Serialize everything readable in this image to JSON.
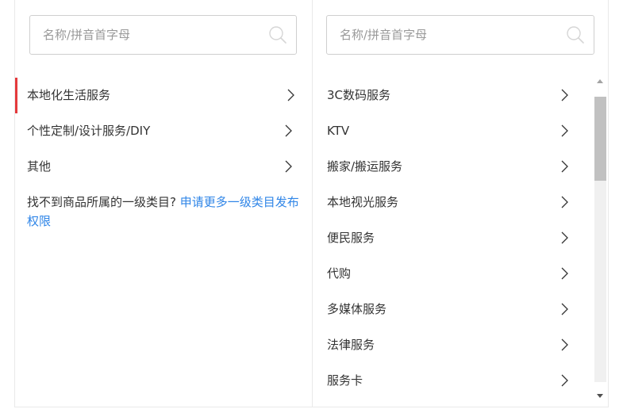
{
  "left_panel": {
    "search": {
      "placeholder": "名称/拼音首字母",
      "value": ""
    },
    "items": [
      {
        "label": "本地化生活服务",
        "active": true
      },
      {
        "label": "个性定制/设计服务/DIY",
        "active": false
      },
      {
        "label": "其他",
        "active": false
      }
    ],
    "hint": {
      "text": "找不到商品所属的一级类目?",
      "link": "申请更多一级类目发布权限"
    }
  },
  "right_panel": {
    "search": {
      "placeholder": "名称/拼音首字母",
      "value": ""
    },
    "items": [
      {
        "label": "3C数码服务"
      },
      {
        "label": "KTV"
      },
      {
        "label": "搬家/搬运服务"
      },
      {
        "label": "本地视光服务"
      },
      {
        "label": "便民服务"
      },
      {
        "label": "代购"
      },
      {
        "label": "多媒体服务"
      },
      {
        "label": "法律服务"
      },
      {
        "label": "服务卡"
      }
    ],
    "scroll_position": 0
  },
  "colors": {
    "active_indicator": "#e4393c",
    "link": "#2f85e7",
    "placeholder": "#999999",
    "border": "#e9e9e9",
    "scroll_thumb": "#c1c1c1"
  },
  "icons": {
    "search": "search-icon",
    "chevron": "chevron-right-icon",
    "scroll_up": "triangle-up-icon",
    "scroll_down": "triangle-down-icon"
  }
}
